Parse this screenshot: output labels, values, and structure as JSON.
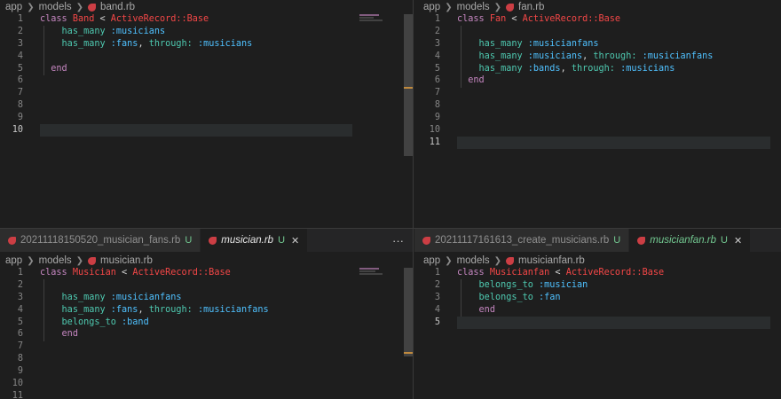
{
  "panes": {
    "top_left": {
      "breadcrumb": {
        "folder1": "app",
        "folder2": "models",
        "file": "band.rb"
      },
      "line_numbers": [
        "1",
        "2",
        "3",
        "4",
        "5",
        "6",
        "7",
        "8",
        "9",
        "10"
      ],
      "code": {
        "l1": {
          "kw": "class",
          "name": "Band",
          "op": "<",
          "base": "ActiveRecord::Base"
        },
        "l2": {
          "meth": "has_many",
          "arg1": ":musicians"
        },
        "l3": {
          "meth": "has_many",
          "arg1": ":fans",
          "punct": ",",
          "through_key": "through:",
          "arg2": ":musicians"
        },
        "l5": {
          "kw": "end"
        }
      }
    },
    "top_right": {
      "breadcrumb": {
        "folder1": "app",
        "folder2": "models",
        "file": "fan.rb"
      },
      "line_numbers": [
        "1",
        "2",
        "3",
        "4",
        "5",
        "6",
        "7",
        "8",
        "9",
        "10",
        "11"
      ],
      "code": {
        "l1": {
          "kw": "class",
          "name": "Fan",
          "op": "<",
          "base": "ActiveRecord::Base"
        },
        "l3": {
          "meth": "has_many",
          "arg1": ":musicianfans"
        },
        "l4": {
          "meth": "has_many",
          "arg1": ":musicians",
          "punct": ",",
          "through_key": "through:",
          "arg2": ":musicianfans"
        },
        "l5": {
          "meth": "has_many",
          "arg1": ":bands",
          "punct": ",",
          "through_key": "through:",
          "arg2": ":musicians"
        },
        "l6": {
          "kw": "end"
        }
      }
    },
    "bottom_left": {
      "tabs": [
        {
          "label": "20211118150520_musician_fans.rb",
          "status": "U"
        },
        {
          "label": "musician.rb",
          "status": "U",
          "close": "✕"
        }
      ],
      "more": "···",
      "breadcrumb": {
        "folder1": "app",
        "folder2": "models",
        "file": "musician.rb"
      },
      "line_numbers": [
        "1",
        "2",
        "3",
        "4",
        "5",
        "6",
        "7",
        "8",
        "9",
        "10",
        "11"
      ],
      "code": {
        "l1": {
          "kw": "class",
          "name": "Musician",
          "op": "<",
          "base": "ActiveRecord::Base"
        },
        "l3": {
          "meth": "has_many",
          "arg1": ":musicianfans"
        },
        "l4": {
          "meth": "has_many",
          "arg1": ":fans",
          "punct": ",",
          "through_key": "through:",
          "arg2": ":musicianfans"
        },
        "l5": {
          "meth": "belongs_to",
          "arg1": ":band"
        },
        "l6": {
          "kw": "end"
        }
      }
    },
    "bottom_right": {
      "tabs": [
        {
          "label": "20211117161613_create_musicians.rb",
          "status": "U"
        },
        {
          "label": "musicianfan.rb",
          "status": "U",
          "close": "✕"
        }
      ],
      "breadcrumb": {
        "folder1": "app",
        "folder2": "models",
        "file": "musicianfan.rb"
      },
      "line_numbers": [
        "1",
        "2",
        "3",
        "4",
        "5"
      ],
      "code": {
        "l1": {
          "kw": "class",
          "name": "Musicianfan",
          "op": "<",
          "base": "ActiveRecord::Base"
        },
        "l2": {
          "meth": "belongs_to",
          "arg1": ":musician"
        },
        "l3": {
          "meth": "belongs_to",
          "arg1": ":fan"
        },
        "l4": {
          "kw": "end"
        }
      }
    }
  },
  "icons": {
    "breadcrumb_separator": "chevron-right-icon",
    "file_type": "ruby-icon"
  }
}
